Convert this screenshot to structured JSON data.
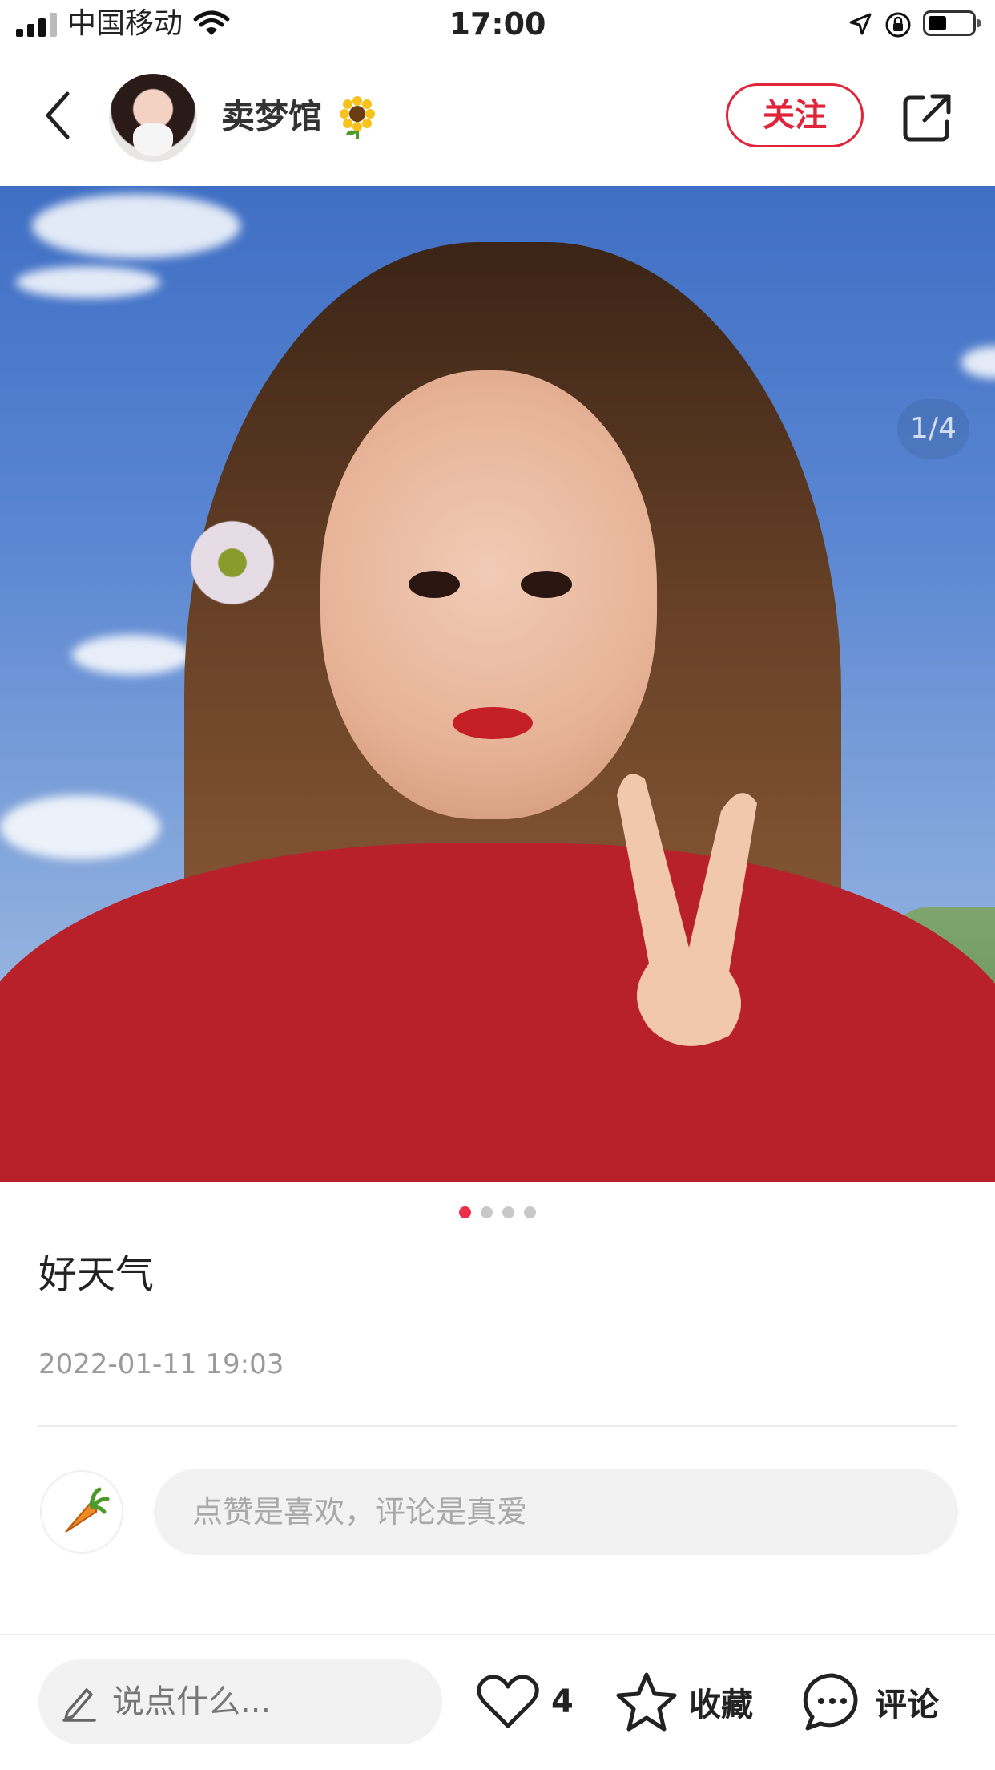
{
  "status_bar": {
    "carrier": "中国移动",
    "time": "17:00"
  },
  "header": {
    "username": "卖梦馆",
    "follow_label": "关注"
  },
  "post": {
    "page_counter": "1/4",
    "image_count": 4,
    "active_image": 1,
    "caption": "好天气",
    "timestamp": "2022-01-11 19:03"
  },
  "comment": {
    "placeholder": "点赞是喜欢，评论是真爱"
  },
  "bottom_bar": {
    "say_placeholder": "说点什么...",
    "like_count": "4",
    "favorite_label": "收藏",
    "comment_label": "评论"
  },
  "colors": {
    "accent": "#e0253a",
    "active_dot": "#ef2e48",
    "input_bg": "#f2f2f2"
  },
  "icons": [
    "back-icon",
    "share-icon",
    "sunflower-icon",
    "heart-icon",
    "star-icon",
    "chat-bubble-icon",
    "pen-icon",
    "carrot-icon"
  ]
}
